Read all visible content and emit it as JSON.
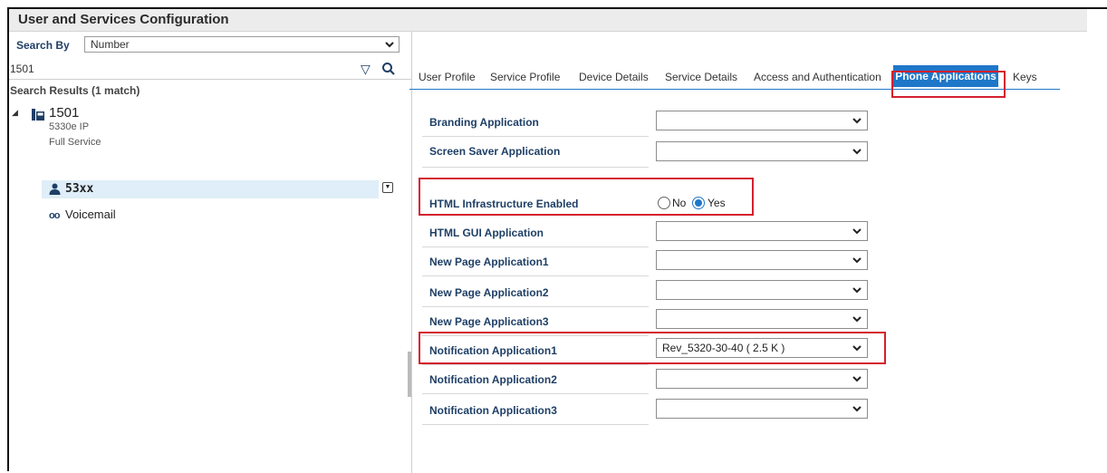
{
  "window": {
    "title": "User and Services Configuration"
  },
  "left": {
    "search_by_label": "Search By",
    "search_by_value": "Number",
    "search_input_value": "1501",
    "results_title": "Search Results (1 match)",
    "tree": {
      "number": "1501",
      "model": "5330e IP",
      "service": "Full Service",
      "user": "53xx",
      "voicemail": "Voicemail"
    }
  },
  "tabs": [
    {
      "label": "User Profile"
    },
    {
      "label": "Service Profile"
    },
    {
      "label": "Device Details"
    },
    {
      "label": "Service Details"
    },
    {
      "label": "Access and Authentication"
    },
    {
      "label": "Phone Applications",
      "active": true
    },
    {
      "label": "Keys"
    }
  ],
  "form": {
    "branding": {
      "label": "Branding Application",
      "value": ""
    },
    "screensaver": {
      "label": "Screen Saver Application",
      "value": ""
    },
    "html_infra": {
      "label": "HTML Infrastructure Enabled",
      "no": "No",
      "yes": "Yes",
      "selected": "Yes"
    },
    "html_gui": {
      "label": "HTML GUI Application",
      "value": ""
    },
    "newpage1": {
      "label": "New Page Application1",
      "value": ""
    },
    "newpage2": {
      "label": "New Page Application2",
      "value": ""
    },
    "newpage3": {
      "label": "New Page Application3",
      "value": ""
    },
    "notif1": {
      "label": "Notification Application1",
      "value": "Rev_5320-30-40 ( 2.5 K )"
    },
    "notif2": {
      "label": "Notification Application2",
      "value": ""
    },
    "notif3": {
      "label": "Notification Application3",
      "value": ""
    }
  },
  "colors": {
    "accent": "#1f77c8",
    "highlight_box": "#d4202e",
    "label": "#1f3f66",
    "selected_row": "#dfeef8"
  },
  "icons": [
    "chevron-down-icon",
    "filter-icon",
    "search-icon",
    "phone-icon",
    "user-icon",
    "voicemail-icon",
    "row-menu-icon",
    "expand-arrow-icon"
  ]
}
